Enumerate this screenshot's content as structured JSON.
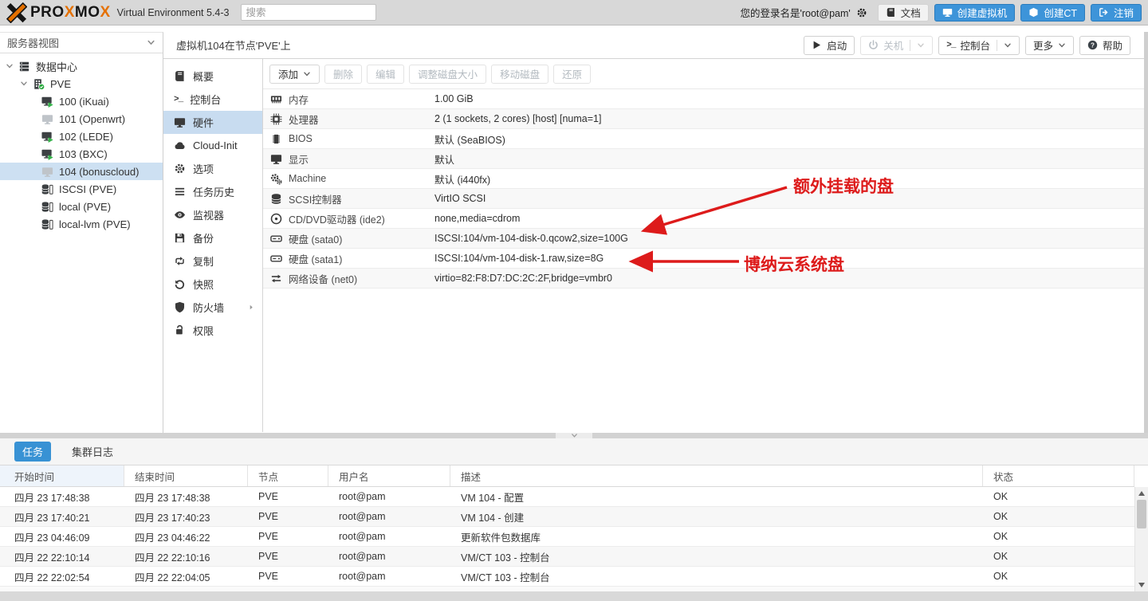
{
  "colors": {
    "accent": "#3892d4",
    "annotation_red": "#dd1b1b",
    "header_bg": "#d8d8d8",
    "selection": "#cde0f2",
    "logo_orange": "#e57000"
  },
  "header": {
    "logo_parts": [
      "PRO",
      "X",
      "MO",
      "X"
    ],
    "version": "Virtual Environment 5.4-3",
    "search_placeholder": "搜索",
    "login_text": "您的登录名是'root@pam'",
    "buttons": [
      {
        "name": "docs-button",
        "label": "文档",
        "icon": "book",
        "style": "light"
      },
      {
        "name": "create-vm-button",
        "label": "创建虚拟机",
        "icon": "monitor",
        "style": "primary"
      },
      {
        "name": "create-ct-button",
        "label": "创建CT",
        "icon": "cube",
        "style": "primary"
      },
      {
        "name": "logout-button",
        "label": "注销",
        "icon": "signout",
        "style": "primary"
      }
    ]
  },
  "sidebar": {
    "view_label": "服务器视图",
    "tree": [
      {
        "name": "datacenter",
        "label": "数据中心",
        "icon": "server",
        "level": 0,
        "expander": true
      },
      {
        "name": "pve",
        "label": "PVE",
        "icon": "node",
        "level": 1,
        "expander": true
      },
      {
        "name": "vm-100",
        "label": "100 (iKuai)",
        "icon": "vm-running",
        "level": 2
      },
      {
        "name": "vm-101",
        "label": "101 (Openwrt)",
        "icon": "vm-stopped",
        "level": 2
      },
      {
        "name": "vm-102",
        "label": "102 (LEDE)",
        "icon": "vm-running",
        "level": 2
      },
      {
        "name": "vm-103",
        "label": "103 (BXC)",
        "icon": "vm-running",
        "level": 2
      },
      {
        "name": "vm-104",
        "label": "104 (bonuscloud)",
        "icon": "vm-stopped",
        "level": 2,
        "selected": true
      },
      {
        "name": "storage-iscsi",
        "label": "ISCSI (PVE)",
        "icon": "storage",
        "level": 2
      },
      {
        "name": "storage-local",
        "label": "local (PVE)",
        "icon": "storage",
        "level": 2
      },
      {
        "name": "storage-local-lvm",
        "label": "local-lvm (PVE)",
        "icon": "storage",
        "level": 2
      }
    ]
  },
  "vm": {
    "title": "虚拟机104在节点'PVE'上",
    "actions": [
      {
        "name": "start-button",
        "label": "启动",
        "icon": "play",
        "enabled": true
      },
      {
        "name": "shutdown-button",
        "label": "关机",
        "icon": "power",
        "enabled": false,
        "split": true
      },
      {
        "name": "console-button",
        "label": "控制台",
        "icon": "terminal",
        "enabled": true,
        "split": true
      },
      {
        "name": "more-button",
        "label": "更多",
        "enabled": true,
        "caret": true
      },
      {
        "name": "help-button",
        "label": "帮助",
        "icon": "help",
        "enabled": true
      }
    ],
    "menu": [
      {
        "name": "overview",
        "label": "概要",
        "icon": "book"
      },
      {
        "name": "console",
        "label": "控制台",
        "icon": "terminal"
      },
      {
        "name": "hardware",
        "label": "硬件",
        "icon": "monitor",
        "selected": true
      },
      {
        "name": "cloud-init",
        "label": "Cloud-Init",
        "icon": "cloud"
      },
      {
        "name": "options",
        "label": "选项",
        "icon": "gear"
      },
      {
        "name": "task-history",
        "label": "任务历史",
        "icon": "list"
      },
      {
        "name": "monitor",
        "label": "监视器",
        "icon": "eye"
      },
      {
        "name": "backup",
        "label": "备份",
        "icon": "floppy"
      },
      {
        "name": "replication",
        "label": "复制",
        "icon": "retweet"
      },
      {
        "name": "snapshots",
        "label": "快照",
        "icon": "undo"
      },
      {
        "name": "firewall",
        "label": "防火墙",
        "icon": "shield",
        "submenu": true
      },
      {
        "name": "permissions",
        "label": "权限",
        "icon": "lock"
      }
    ],
    "toolbar": [
      {
        "name": "add-button",
        "label": "添加",
        "enabled": true,
        "caret": true
      },
      {
        "name": "remove-button",
        "label": "删除",
        "enabled": false
      },
      {
        "name": "edit-button",
        "label": "编辑",
        "enabled": false
      },
      {
        "name": "resize-disk-button",
        "label": "调整磁盘大小",
        "enabled": false
      },
      {
        "name": "move-disk-button",
        "label": "移动磁盘",
        "enabled": false
      },
      {
        "name": "revert-button",
        "label": "还原",
        "enabled": false
      }
    ],
    "hardware": [
      {
        "name": "memory",
        "icon": "memory",
        "label": "内存",
        "value": "1.00 GiB"
      },
      {
        "name": "processors",
        "icon": "cpu",
        "label": "处理器",
        "value": "2 (1 sockets, 2 cores) [host] [numa=1]"
      },
      {
        "name": "bios",
        "icon": "chip",
        "label": "BIOS",
        "value": "默认 (SeaBIOS)"
      },
      {
        "name": "display",
        "icon": "monitor",
        "label": "显示",
        "value": "默认"
      },
      {
        "name": "machine",
        "icon": "gears",
        "label": "Machine",
        "value": "默认 (i440fx)"
      },
      {
        "name": "scsi-controller",
        "icon": "db",
        "label": "SCSI控制器",
        "value": "VirtIO SCSI"
      },
      {
        "name": "cdrom-ide2",
        "icon": "disc",
        "label": "CD/DVD驱动器 (ide2)",
        "value": "none,media=cdrom"
      },
      {
        "name": "harddisk-sata0",
        "icon": "hdd",
        "label": "硬盘 (sata0)",
        "value": "ISCSI:104/vm-104-disk-0.qcow2,size=100G"
      },
      {
        "name": "harddisk-sata1",
        "icon": "hdd",
        "label": "硬盘 (sata1)",
        "value": "ISCSI:104/vm-104-disk-1.raw,size=8G"
      },
      {
        "name": "network-net0",
        "icon": "net",
        "label": "网络设备 (net0)",
        "value": "virtio=82:F8:D7:DC:2C:2F,bridge=vmbr0"
      }
    ]
  },
  "annotations": [
    {
      "text": "额外挂载的盘"
    },
    {
      "text": "博纳云系统盘"
    }
  ],
  "tasks": {
    "tabs": [
      {
        "name": "tab-tasks",
        "label": "任务",
        "active": true
      },
      {
        "name": "tab-cluster-log",
        "label": "集群日志",
        "active": false
      }
    ],
    "columns": [
      "开始时间",
      "结束时间",
      "节点",
      "用户名",
      "描述",
      "状态"
    ],
    "sorted_column": "开始时间",
    "rows": [
      [
        "四月 23 17:48:38",
        "四月 23 17:48:38",
        "PVE",
        "root@pam",
        "VM 104 - 配置",
        "OK"
      ],
      [
        "四月 23 17:40:21",
        "四月 23 17:40:23",
        "PVE",
        "root@pam",
        "VM 104 - 创建",
        "OK"
      ],
      [
        "四月 23 04:46:09",
        "四月 23 04:46:22",
        "PVE",
        "root@pam",
        "更新软件包数据库",
        "OK"
      ],
      [
        "四月 22 22:10:14",
        "四月 22 22:10:16",
        "PVE",
        "root@pam",
        "VM/CT 103 - 控制台",
        "OK"
      ],
      [
        "四月 22 22:02:54",
        "四月 22 22:04:05",
        "PVE",
        "root@pam",
        "VM/CT 103 - 控制台",
        "OK"
      ]
    ]
  },
  "icons": {
    "proxmox-logo": "stylized X",
    "search": "text-input",
    "gear": "⚙",
    "book": "📖",
    "monitor": "🖵",
    "cube": "cube",
    "signout": "exit-arrow",
    "server": "stacked-server",
    "node": "building+check",
    "vm-running": "monitor+green-play",
    "vm-stopped": "gray-monitor",
    "storage": "database",
    "play": "▶",
    "power": "power-symbol",
    "terminal": ">_",
    "help": "?",
    "cloud": "☁",
    "list": "≡",
    "eye": "eye",
    "floppy": "save-disk",
    "retweet": "⇆",
    "undo": "↺",
    "shield": "shield",
    "lock": "lock",
    "memory": "ram-module",
    "cpu": "processor-chip",
    "chip": "bios-chip",
    "gears": "⚙⚙",
    "db": "cylinder",
    "disc": "◎",
    "hdd": "hard-disk",
    "net": "⇄",
    "caret-down": "⌄",
    "caret-right": "›",
    "sort-down": "↓"
  }
}
